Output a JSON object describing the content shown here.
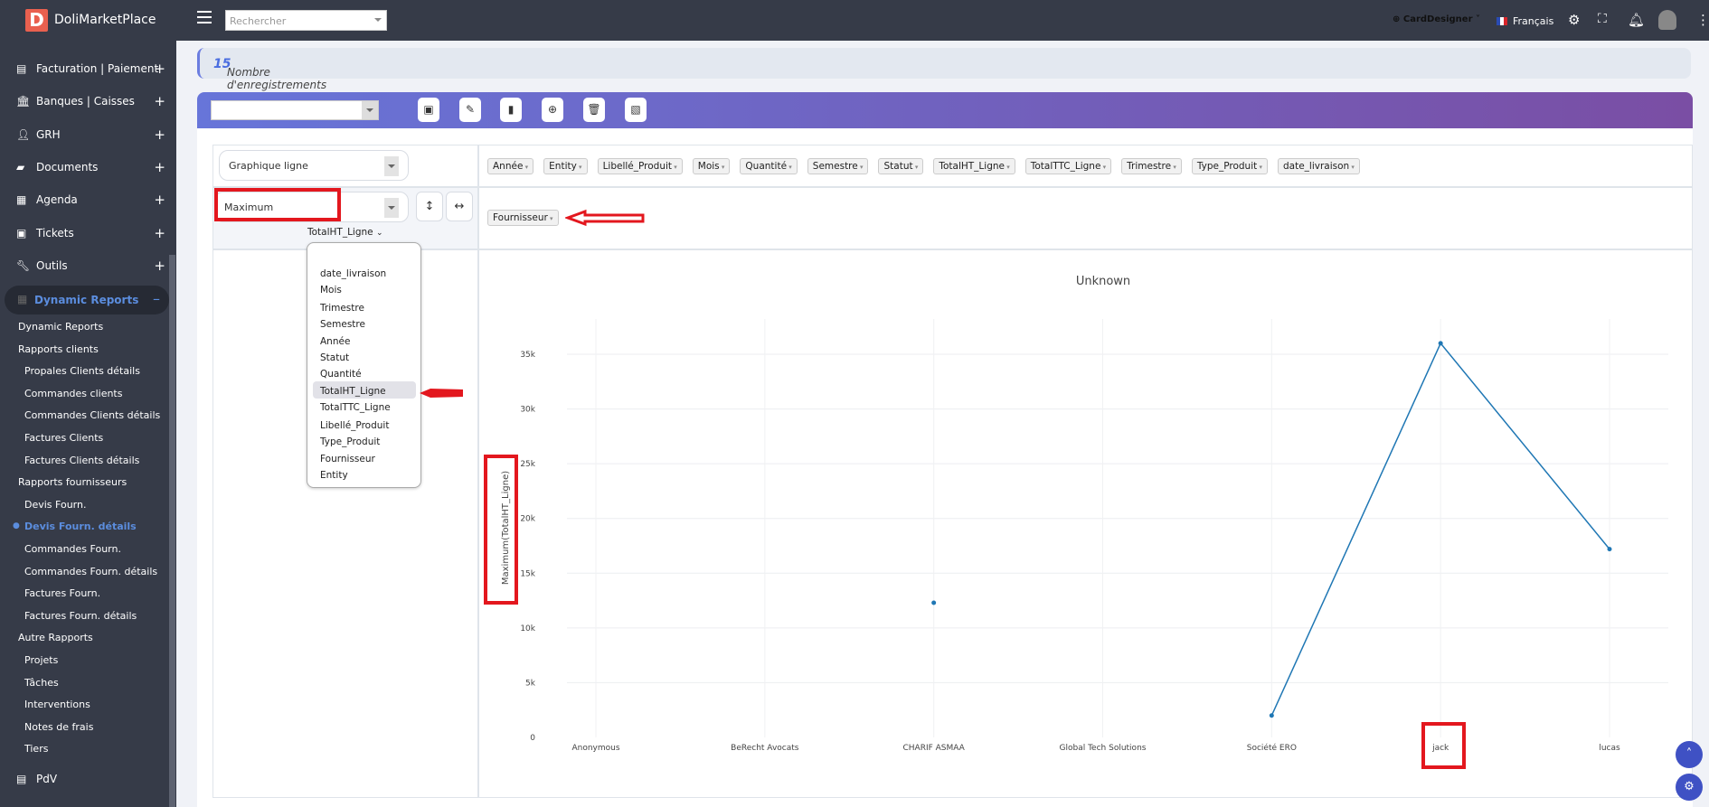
{
  "header": {
    "logo_letter": "D",
    "app_name": "DoliMarketPlace",
    "search_placeholder": "Rechercher",
    "entity": "CardDesigner",
    "language": "Français"
  },
  "sidebar": {
    "menus": [
      {
        "label": "Facturation | Paiement",
        "icon": "invoice-icon"
      },
      {
        "label": "Banques | Caisses",
        "icon": "bank-icon"
      },
      {
        "label": "GRH",
        "icon": "user-icon"
      },
      {
        "label": "Documents",
        "icon": "folder-icon"
      },
      {
        "label": "Agenda",
        "icon": "calendar-icon"
      },
      {
        "label": "Tickets",
        "icon": "ticket-icon"
      },
      {
        "label": "Outils",
        "icon": "wrench-icon"
      }
    ],
    "active_menu": "Dynamic Reports",
    "sub_items": [
      {
        "label": "Dynamic Reports",
        "level": 1
      },
      {
        "label": "Rapports clients",
        "level": 1
      },
      {
        "label": "Propales Clients détails",
        "level": 2
      },
      {
        "label": "Commandes clients",
        "level": 2
      },
      {
        "label": "Commandes Clients détails",
        "level": 2
      },
      {
        "label": "Factures Clients",
        "level": 2
      },
      {
        "label": "Factures Clients détails",
        "level": 2
      },
      {
        "label": "Rapports fournisseurs",
        "level": 1
      },
      {
        "label": "Devis Fourn.",
        "level": 2
      },
      {
        "label": "Devis Fourn. détails",
        "level": 2,
        "active": true
      },
      {
        "label": "Commandes Fourn.",
        "level": 2
      },
      {
        "label": "Commandes Fourn. détails",
        "level": 2
      },
      {
        "label": "Factures Fourn.",
        "level": 2
      },
      {
        "label": "Factures Fourn. détails",
        "level": 2
      },
      {
        "label": "Autre Rapports",
        "level": 1
      },
      {
        "label": "Projets",
        "level": 2
      },
      {
        "label": "Tâches",
        "level": 2
      },
      {
        "label": "Interventions",
        "level": 2
      },
      {
        "label": "Notes de frais",
        "level": 2
      },
      {
        "label": "Tiers",
        "level": 2
      }
    ],
    "last_menu": "PdV"
  },
  "info": {
    "label": "Nombre d'enregistrements dans la source de données :",
    "count": "15"
  },
  "pivot": {
    "renderer": "Graphique ligne",
    "aggregator": "Maximum",
    "aggregator_field": "TotalHT_Ligne",
    "unused_fields": [
      "Année",
      "Entity",
      "Libellé_Produit",
      "Mois",
      "Quantité",
      "Semestre",
      "Statut",
      "TotalHT_Ligne",
      "TotalTTC_Ligne",
      "Trimestre",
      "Type_Produit",
      "date_livraison"
    ],
    "row_fields": [
      "Fournisseur"
    ],
    "field_menu": [
      "date_livraison",
      "Mois",
      "Trimestre",
      "Semestre",
      "Année",
      "Statut",
      "Quantité",
      "TotalHT_Ligne",
      "TotalTTC_Ligne",
      "Libellé_Produit",
      "Type_Produit",
      "Fournisseur",
      "Entity"
    ],
    "field_menu_selected": "TotalHT_Ligne"
  },
  "colors": {
    "line": "#1f77b4",
    "accent": "#3f51c4",
    "annotation": "#e3171e"
  },
  "chart_data": {
    "type": "line",
    "title": "Unknown",
    "xlabel": "",
    "ylabel": "Maximum(TotalHT_Ligne)",
    "categories": [
      "Anonymous",
      "BeRecht Avocats",
      "CHARIF ASMAA",
      "Global Tech Solutions",
      "Société ERO",
      "jack",
      "lucas"
    ],
    "values": [
      null,
      null,
      12300,
      null,
      2000,
      36000,
      17200
    ],
    "ylim": [
      0,
      37500
    ],
    "yticks": [
      0,
      5000,
      10000,
      15000,
      20000,
      25000,
      30000,
      35000
    ],
    "ytick_labels": [
      "0",
      "5k",
      "10k",
      "15k",
      "20k",
      "25k",
      "30k",
      "35k"
    ],
    "grid": true
  }
}
